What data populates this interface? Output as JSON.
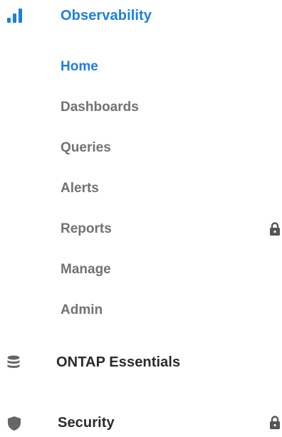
{
  "sections": {
    "observability": {
      "label": "Observability",
      "icon": "bar-chart-icon",
      "active": true,
      "items": [
        {
          "label": "Home",
          "active": true,
          "locked": false
        },
        {
          "label": "Dashboards",
          "active": false,
          "locked": false
        },
        {
          "label": "Queries",
          "active": false,
          "locked": false
        },
        {
          "label": "Alerts",
          "active": false,
          "locked": false
        },
        {
          "label": "Reports",
          "active": false,
          "locked": true
        },
        {
          "label": "Manage",
          "active": false,
          "locked": false
        },
        {
          "label": "Admin",
          "active": false,
          "locked": false
        }
      ]
    },
    "ontap": {
      "label": "ONTAP Essentials",
      "icon": "database-icon",
      "locked": false
    },
    "security": {
      "label": "Security",
      "icon": "shield-icon",
      "locked": true
    }
  },
  "colors": {
    "accent": "#1d7fe0",
    "item_text": "#727272",
    "section_text": "#2b2b2b",
    "icon_gray": "#666666"
  }
}
